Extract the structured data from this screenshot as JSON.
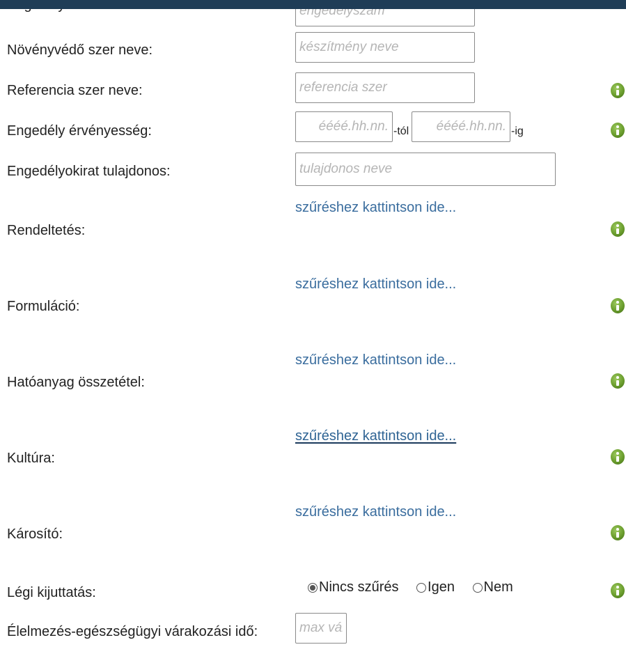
{
  "fields": {
    "license_number": {
      "label": "Engedély száma:",
      "placeholder": "engedélyszám"
    },
    "product_name": {
      "label": "Növényvédő szer neve:",
      "placeholder": "készítmény neve"
    },
    "reference_product": {
      "label": "Referencia szer neve:",
      "placeholder": "referencia szer"
    },
    "validity": {
      "label": "Engedély érvényesség:",
      "from_placeholder": "éééé.hh.nn.",
      "from_suffix": "-tól",
      "to_placeholder": "éééé.hh.nn.",
      "to_suffix": "-ig"
    },
    "holder": {
      "label": "Engedélyokirat tulajdonos:",
      "placeholder": "tulajdonos neve"
    },
    "purpose": {
      "label": "Rendeltetés:",
      "link": "szűréshez kattintson ide..."
    },
    "formulation": {
      "label": "Formuláció:",
      "link": "szűréshez kattintson ide..."
    },
    "active_ingredient": {
      "label": "Hatóanyag összetétel:",
      "link": "szűréshez kattintson ide..."
    },
    "crop": {
      "label": "Kultúra:",
      "link": "szűréshez kattintson ide..."
    },
    "pest": {
      "label": "Károsító:",
      "link": "szűréshez kattintson ide..."
    },
    "aerial": {
      "label": "Légi kijuttatás:",
      "options": [
        "Nincs szűrés",
        "Igen",
        "Nem"
      ],
      "selected": "Nincs szűrés"
    },
    "waiting_period": {
      "label": "Élelmezés-egészségügyi várakozási idő:",
      "placeholder": "max várakozás"
    }
  },
  "colors": {
    "header": "#1f3d57",
    "link": "#3a6d9e",
    "info_icon": "#6a9d2d"
  },
  "icons": {
    "info": "info-icon"
  }
}
